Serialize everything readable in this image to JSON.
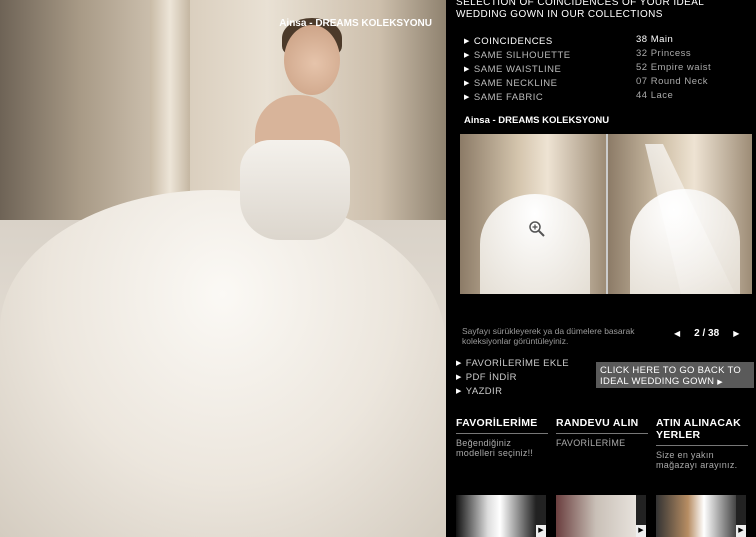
{
  "hero": {
    "caption": "Ainsa - DREAMS KOLEKSYONU"
  },
  "headline": "SELECTION OF COINCIDENCES OF YOUR IDEAL WEDDING GOWN IN OUR COLLECTIONS",
  "coincidences": [
    {
      "label": "COINCIDENCES",
      "value": "38 Main"
    },
    {
      "label": "SAME SILHOUETTE",
      "value": "32 Princess"
    },
    {
      "label": "SAME WAISTLINE",
      "value": "52 Empire waist"
    },
    {
      "label": "SAME NECKLINE",
      "value": "07 Round Neck"
    },
    {
      "label": "SAME FABRIC",
      "value": "44 Lace"
    }
  ],
  "collection_title": "Ainsa - DREAMS KOLEKSYONU",
  "viewer": {
    "hint": "Sayfayı sürükleyerek ya da dümelere basarak koleksiyonlar görüntüleyiniz.",
    "page": "2 / 38",
    "prev_icon": "arrow-left-icon",
    "next_icon": "arrow-right-icon"
  },
  "actions": [
    "FAVORİLERİME EKLE",
    "PDF İNDİR",
    "YAZDIR"
  ],
  "back_button": "CLICK HERE TO GO BACK TO IDEAL WEDDING GOWN",
  "columns": [
    {
      "heading": "FAVORİLERİME",
      "text": "Beğendiğiniz modelleri seçiniz!!"
    },
    {
      "heading": "RANDEVU ALIN",
      "text": "FAVORİLERİME"
    },
    {
      "heading": "ATIN ALINACAK YERLER",
      "text": "Size en yakın mağazayı arayınız."
    }
  ],
  "colors": {
    "background": "#000000",
    "button": "#5a5a5a",
    "muted_text": "#aaaaaa"
  }
}
